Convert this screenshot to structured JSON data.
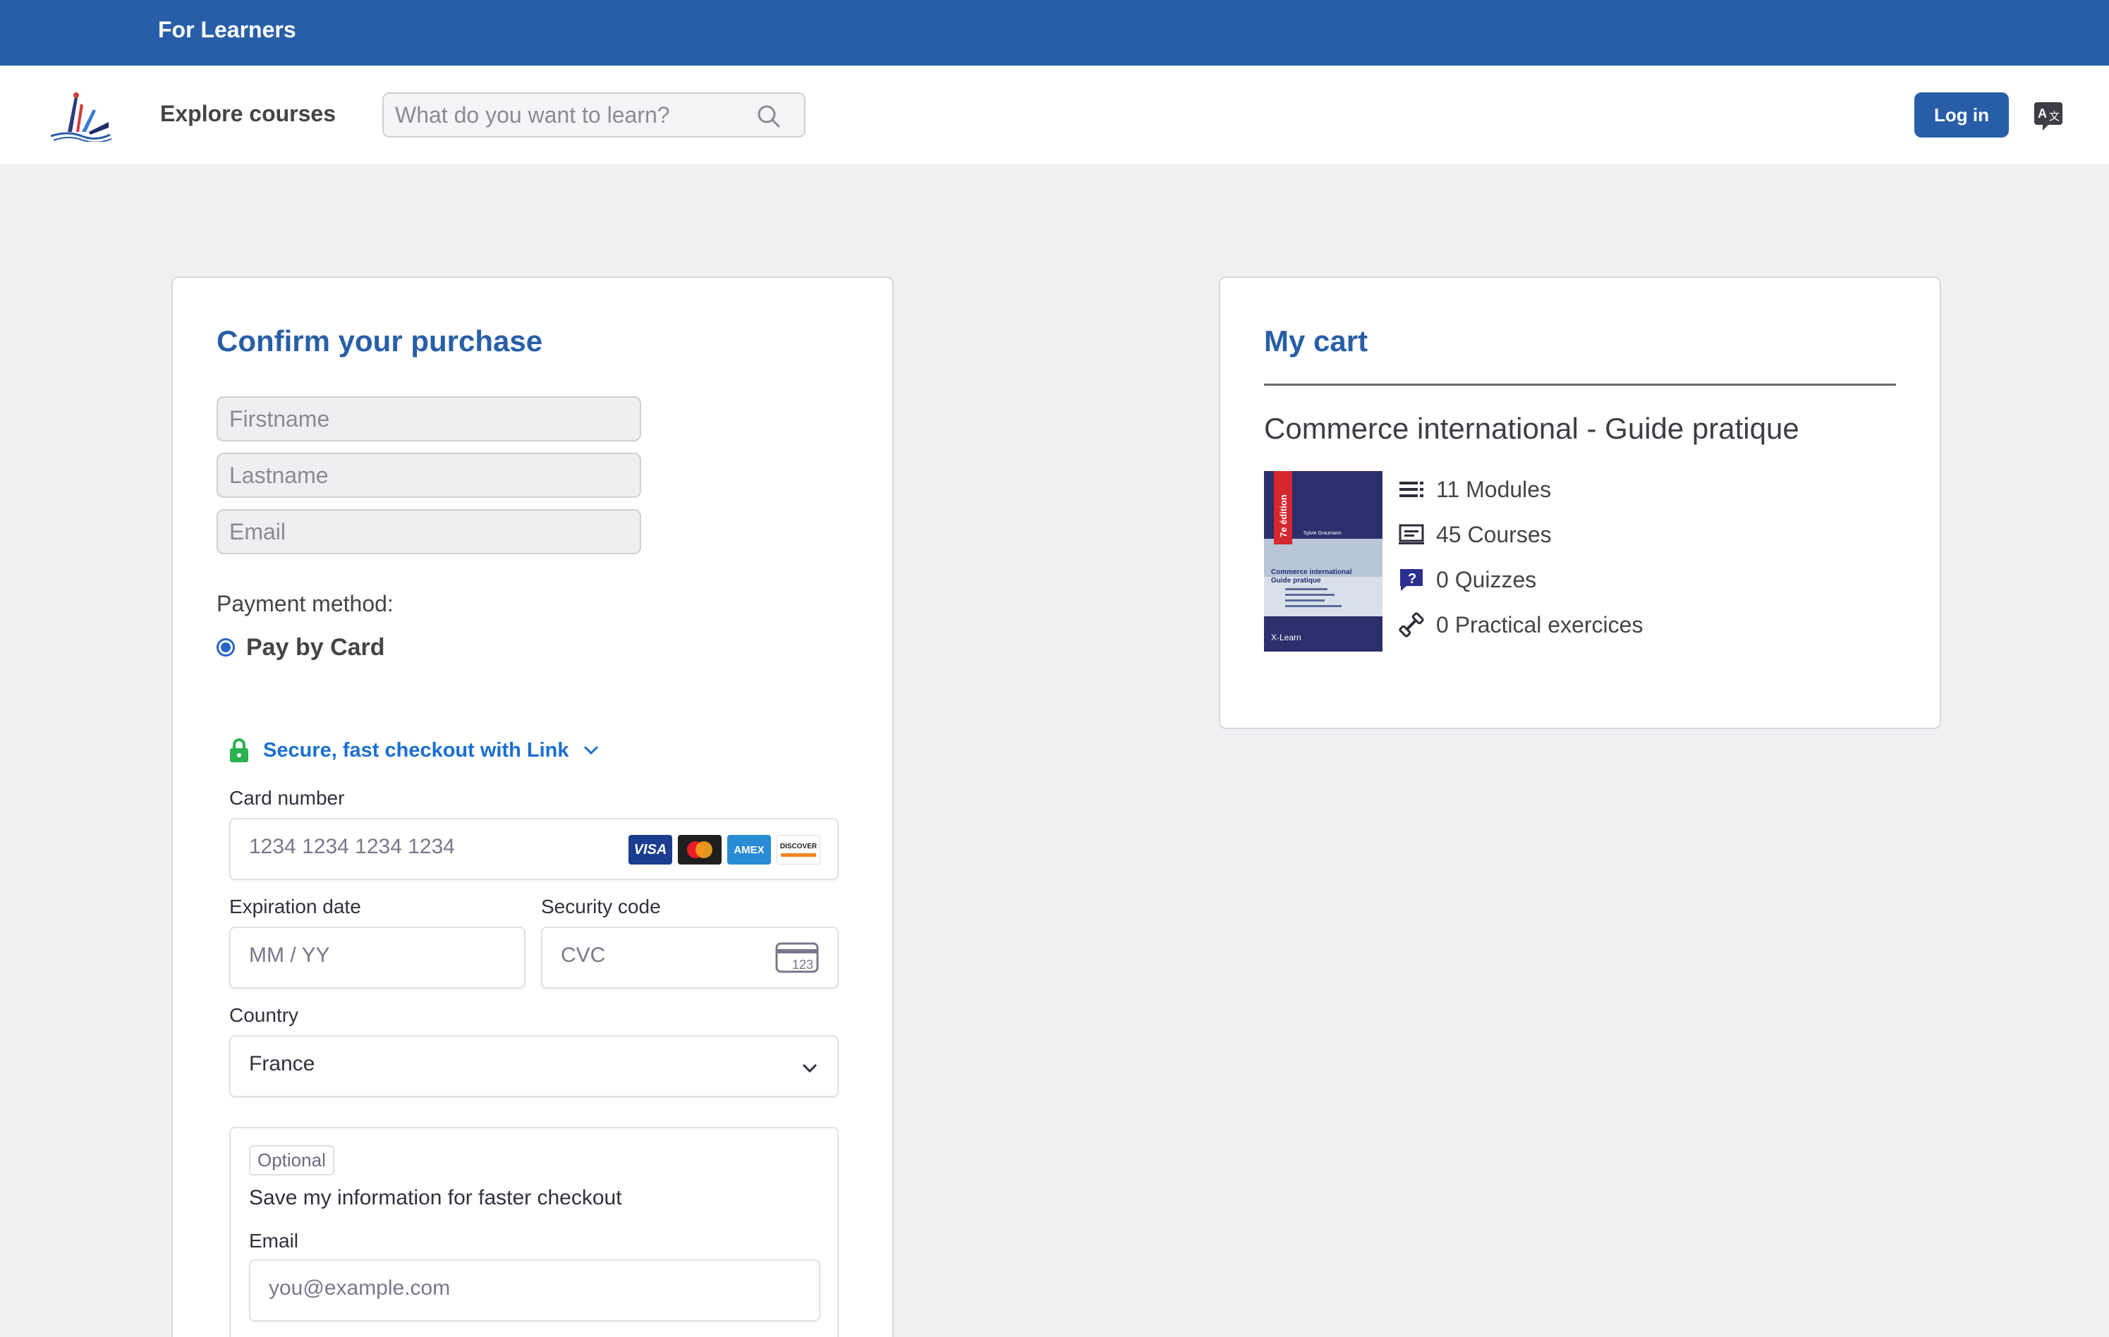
{
  "topbar": {
    "label": "For Learners"
  },
  "nav": {
    "explore": "Explore courses",
    "search_placeholder": "What do you want to learn?",
    "login": "Log in"
  },
  "purchase": {
    "title": "Confirm your purchase",
    "firstname_placeholder": "Firstname",
    "lastname_placeholder": "Lastname",
    "email_placeholder": "Email",
    "payment_method_label": "Payment method:",
    "pay_by_card": "Pay by Card"
  },
  "stripe": {
    "link_text": "Secure, fast checkout with Link",
    "card_number_label": "Card number",
    "card_number_placeholder": "1234 1234 1234 1234",
    "brands": [
      "VISA",
      "AMEX",
      "DISCOVER"
    ],
    "expiration_label": "Expiration date",
    "expiration_placeholder": "MM / YY",
    "security_label": "Security code",
    "security_placeholder": "CVC",
    "cvc_icon_text": "123",
    "country_label": "Country",
    "country_value": "France",
    "optional_tag": "Optional",
    "save_info_text": "Save my information for faster checkout",
    "email_label": "Email",
    "email_placeholder": "you@example.com"
  },
  "cart": {
    "title": "My cart",
    "product_title": "Commerce international - Guide pratique",
    "book_cover": {
      "edition": "7e édition",
      "author": "Sylvie Graumann",
      "title_line1": "Commerce international",
      "title_line2": "Guide pratique",
      "publisher": "X-Learn"
    },
    "features": [
      {
        "icon": "list-icon",
        "text": "11 Modules"
      },
      {
        "icon": "laptop-icon",
        "text": "45 Courses"
      },
      {
        "icon": "quiz-icon",
        "text": "0 Quizzes"
      },
      {
        "icon": "dumbbell-icon",
        "text": "0 Practical exercices"
      }
    ]
  },
  "colors": {
    "brand_blue": "#285ea8",
    "link_blue": "#1a6fd1",
    "lock_green": "#2bb14f",
    "page_bg": "#f1f1f3"
  }
}
